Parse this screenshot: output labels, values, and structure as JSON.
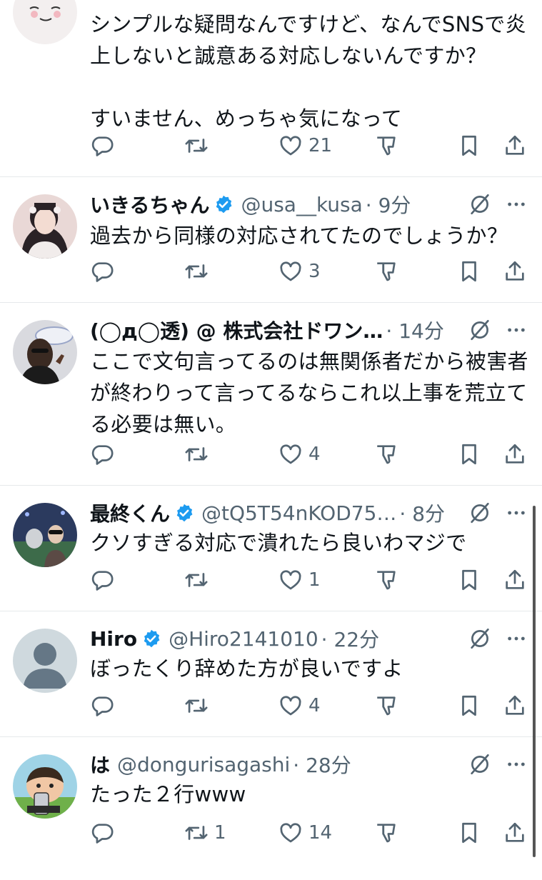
{
  "colors": {
    "accent": "#1d9bf0",
    "secondary": "#536471",
    "divider": "#e6e9eb"
  },
  "tweets": [
    {
      "name": "",
      "handle": "",
      "time": "",
      "text": "シンプルな疑問なんですけど、なんでSNSで炎上しないと誠意ある対応しないんですか？\n\nすいません、めっちゃ気になって",
      "replies": "",
      "retweets": "",
      "likes": "21"
    },
    {
      "name": "いきるちゃん",
      "handle": "@usa__kusa",
      "time": "· 9分",
      "text": "過去から同様の対応されてたのでしょうか？",
      "replies": "",
      "retweets": "",
      "likes": "3"
    },
    {
      "name": "(◯д◯透) @ 株式会社ドワン…",
      "handle": "",
      "time": "· 14分",
      "text": "ここで文句言ってるのは無関係者だから被害者が終わりって言ってるならこれ以上事を荒立てる必要は無い。",
      "replies": "",
      "retweets": "",
      "likes": "4"
    },
    {
      "name": "最終くん",
      "handle": "@tQ5T54nKOD75…",
      "time": "· 8分",
      "text": "クソすぎる対応で潰れたら良いわマジで",
      "replies": "",
      "retweets": "",
      "likes": "1"
    },
    {
      "name": "Hiro",
      "handle": "@Hiro2141010",
      "time": "· 22分",
      "text": "ぼったくり辞めた方が良いですよ",
      "replies": "",
      "retweets": "",
      "likes": "4"
    },
    {
      "name": "は",
      "handle": "@dongurisagashi",
      "time": "· 28分",
      "text": "たった２行www",
      "replies": "",
      "retweets": "1",
      "likes": "14"
    }
  ]
}
